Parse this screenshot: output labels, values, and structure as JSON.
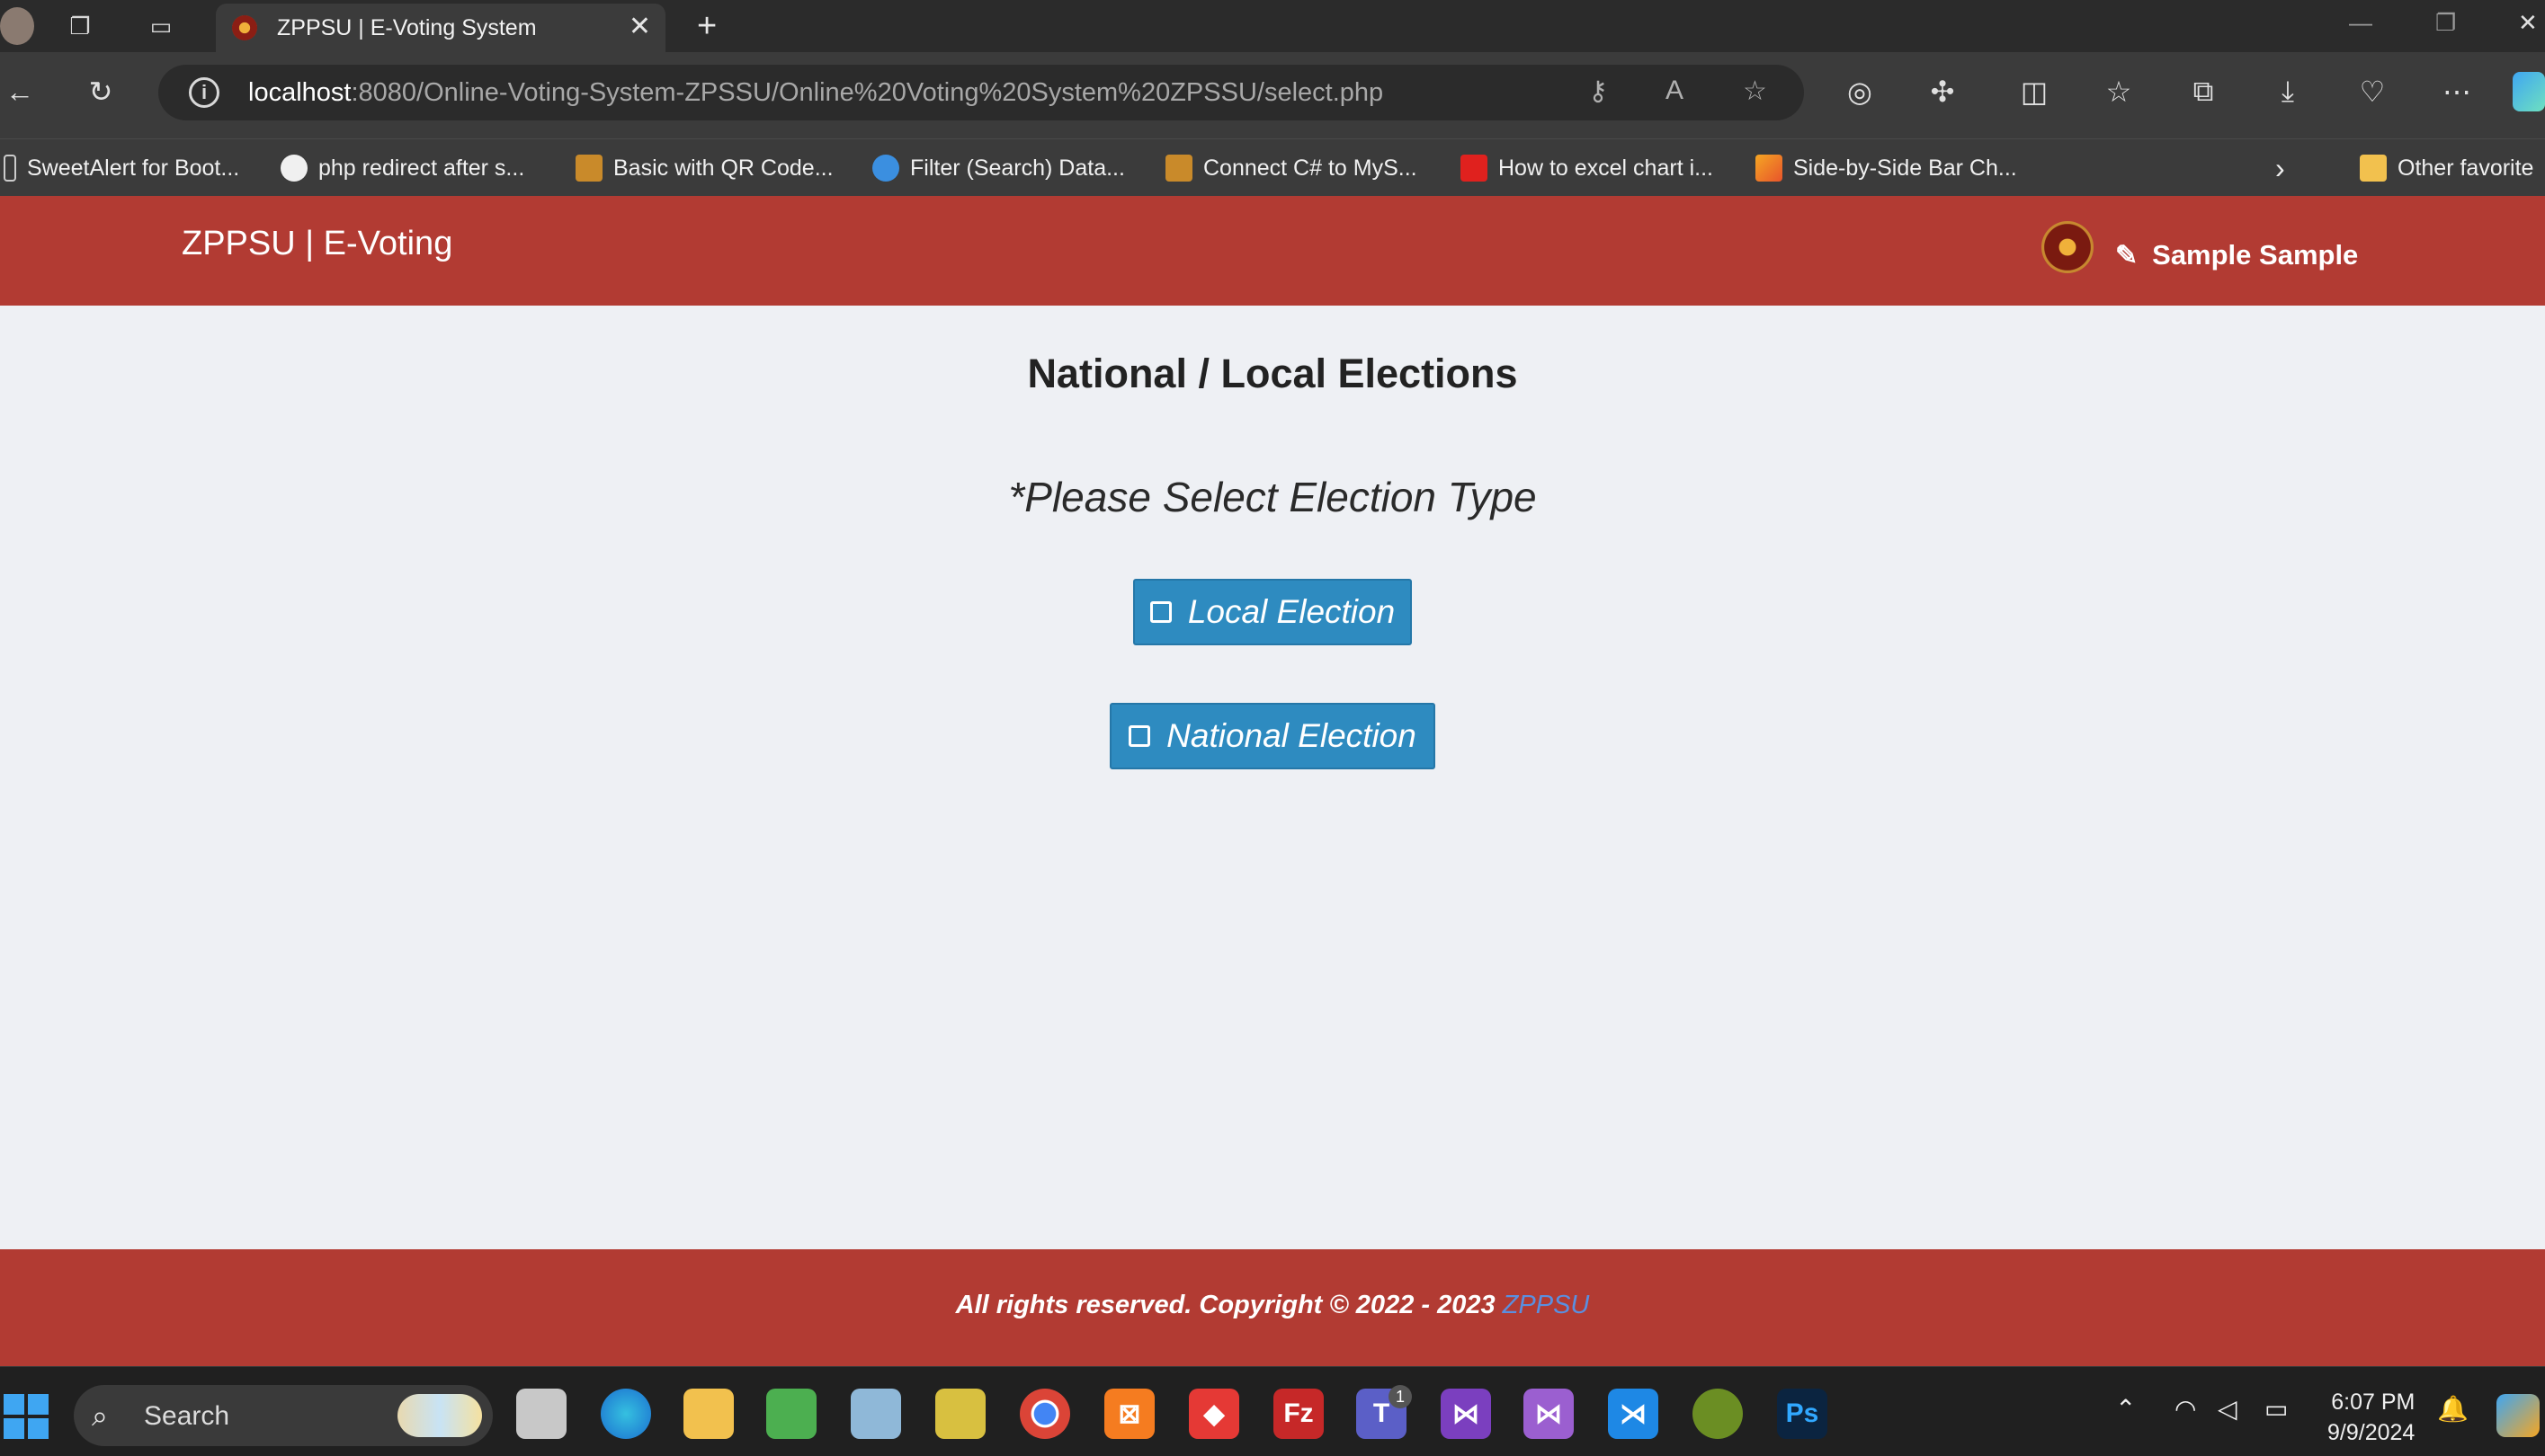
{
  "browser": {
    "tab_title": "ZPPSU | E-Voting System",
    "url_host": "localhost",
    "url_rest": ":8080/Online-Voting-System-ZPSSU/Online%20Voting%20System%20ZPSSU/select.php",
    "bookmarks": [
      {
        "label": "SweetAlert for Boot...",
        "icon": "page-icon"
      },
      {
        "label": "php redirect after s...",
        "icon": "github-icon"
      },
      {
        "label": "Basic with QR Code...",
        "icon": "site-icon"
      },
      {
        "label": "Filter (Search) Data...",
        "icon": "asp-icon"
      },
      {
        "label": "Connect C# to MyS...",
        "icon": "site-icon"
      },
      {
        "label": "How to excel chart i...",
        "icon": "n-icon"
      },
      {
        "label": "Side-by-Side Bar Ch...",
        "icon": "chart-icon"
      }
    ],
    "other_favorites": "Other favorite"
  },
  "navbar": {
    "brand": "ZPPSU | E-Voting",
    "user_name": "Sample Sample"
  },
  "main": {
    "heading": "National / Local Elections",
    "subheading": "*Please Select Election Type",
    "local_button": "Local Election",
    "national_button": "National Election"
  },
  "footer": {
    "copyright": "All rights reserved. Copyright © 2022 - 2023 ",
    "link": "ZPPSU"
  },
  "taskbar": {
    "search_label": "Search",
    "teams_badge": "1",
    "time": "6:07 PM",
    "date": "9/9/2024"
  },
  "colors": {
    "brand_red": "#b23b33",
    "button_blue": "#2e8bc0",
    "page_bg": "#eef0f4"
  }
}
